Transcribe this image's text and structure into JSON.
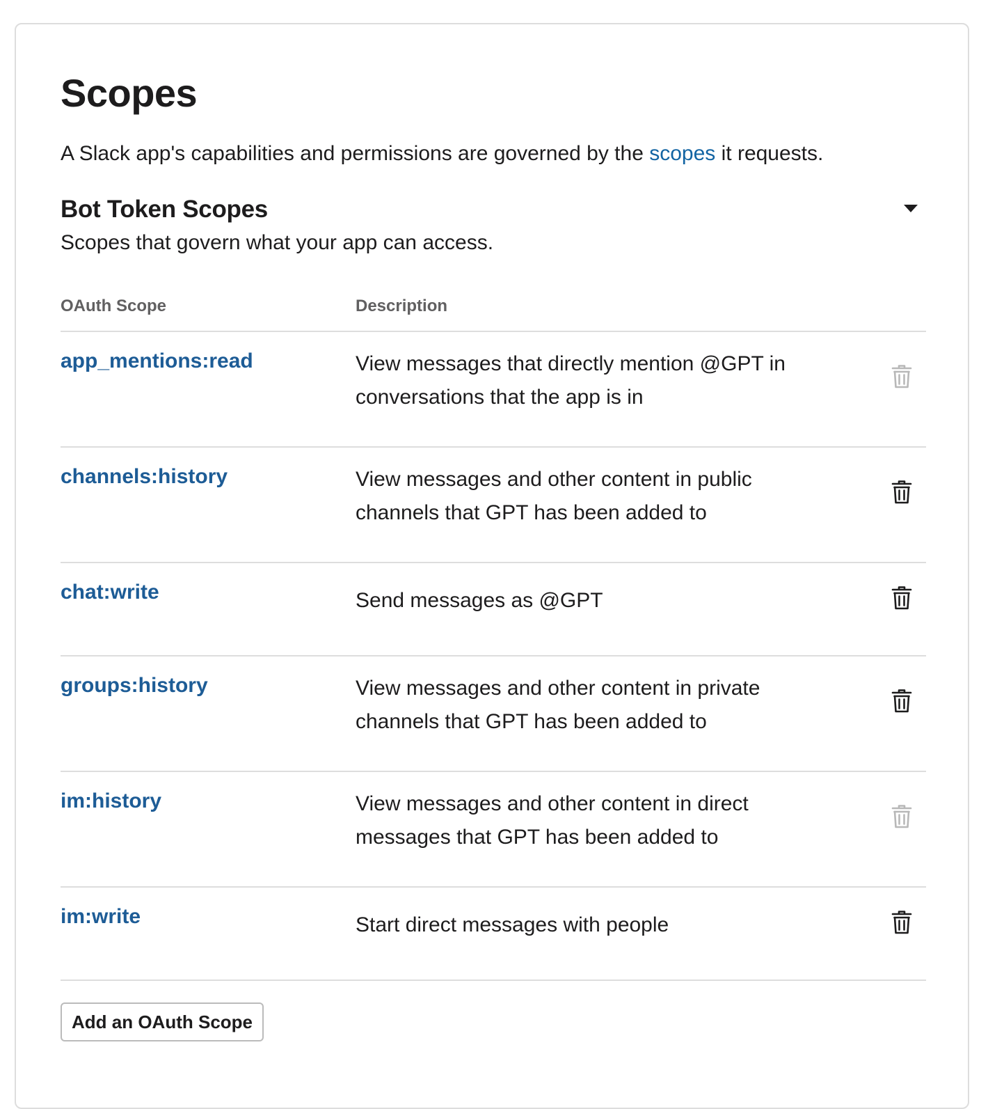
{
  "header": {
    "title": "Scopes",
    "intro_before": "A Slack app's capabilities and permissions are governed by the ",
    "intro_link": "scopes",
    "intro_after": " it requests."
  },
  "section": {
    "title": "Bot Token Scopes",
    "subtitle": "Scopes that govern what your app can access.",
    "toggle_icon": "caret-down-icon"
  },
  "table": {
    "columns": {
      "scope": "OAuth Scope",
      "description": "Description"
    },
    "rows": [
      {
        "scope": "app_mentions:read",
        "description": "View messages that directly mention @GPT in conversations that the app is in",
        "delete_enabled": false
      },
      {
        "scope": "channels:history",
        "description": "View messages and other content in public channels that GPT has been added to",
        "delete_enabled": true
      },
      {
        "scope": "chat:write",
        "description": "Send messages as @GPT",
        "delete_enabled": true
      },
      {
        "scope": "groups:history",
        "description": "View messages and other content in private channels that GPT has been added to",
        "delete_enabled": true
      },
      {
        "scope": "im:history",
        "description": "View messages and other content in direct messages that GPT has been added to",
        "delete_enabled": false
      },
      {
        "scope": "im:write",
        "description": "Start direct messages with people",
        "delete_enabled": true
      }
    ],
    "delete_icon": "trash-icon",
    "colors": {
      "enabled": "#1d1c1d",
      "disabled": "#b8b8b8",
      "link": "#1264a3",
      "scope": "#1d5c96"
    }
  },
  "actions": {
    "add_scope_label": "Add an OAuth Scope"
  }
}
